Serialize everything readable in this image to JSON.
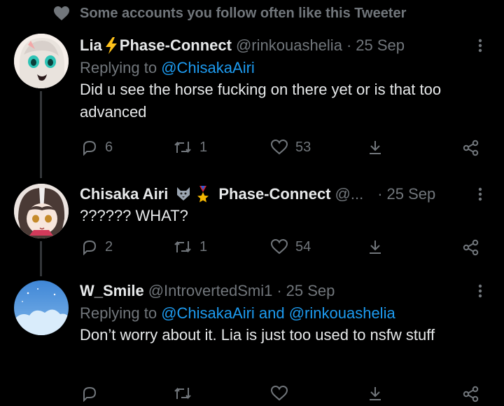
{
  "social_context": {
    "text": "Some accounts you follow often like this Tweeter"
  },
  "tweets": [
    {
      "name": "Lia",
      "badge_text": "Phase-Connect",
      "handle": "@rinkouashelia",
      "dot": "·",
      "date": "25 Sep",
      "replying_prefix": "Replying to",
      "replying_to": "@ChisakaAiri",
      "text": "Did u see the horse fucking on there yet or is that too advanced",
      "replies": "6",
      "retweets": "1",
      "likes": "53"
    },
    {
      "name": "Chisaka Airi",
      "badge_text": "Phase-Connect",
      "handle": "@...",
      "dot": "·",
      "date": "25 Sep",
      "text": "?????? WHAT?",
      "replies": "2",
      "retweets": "1",
      "likes": "54"
    },
    {
      "name": "W_Smile",
      "handle": "@IntrovertedSmi1",
      "dot": "·",
      "date": "25 Sep",
      "replying_prefix": "Replying to",
      "replying_to": "@ChisakaAiri and @rinkouashelia",
      "text": "Don’t worry about it. Lia is just too used to nsfw stuff",
      "replies": "",
      "retweets": "",
      "likes": ""
    }
  ],
  "colors": {
    "link": "#1d9bf0",
    "muted": "#71767b",
    "text": "#e7e9ea",
    "background": "#000000",
    "bolt": "#ffd400"
  },
  "icons": [
    "heart-icon",
    "reply-icon",
    "retweet-icon",
    "like-icon",
    "bookmark-icon",
    "share-icon",
    "more-icon",
    "lightning-icon",
    "wolf-icon",
    "medal-icon"
  ]
}
